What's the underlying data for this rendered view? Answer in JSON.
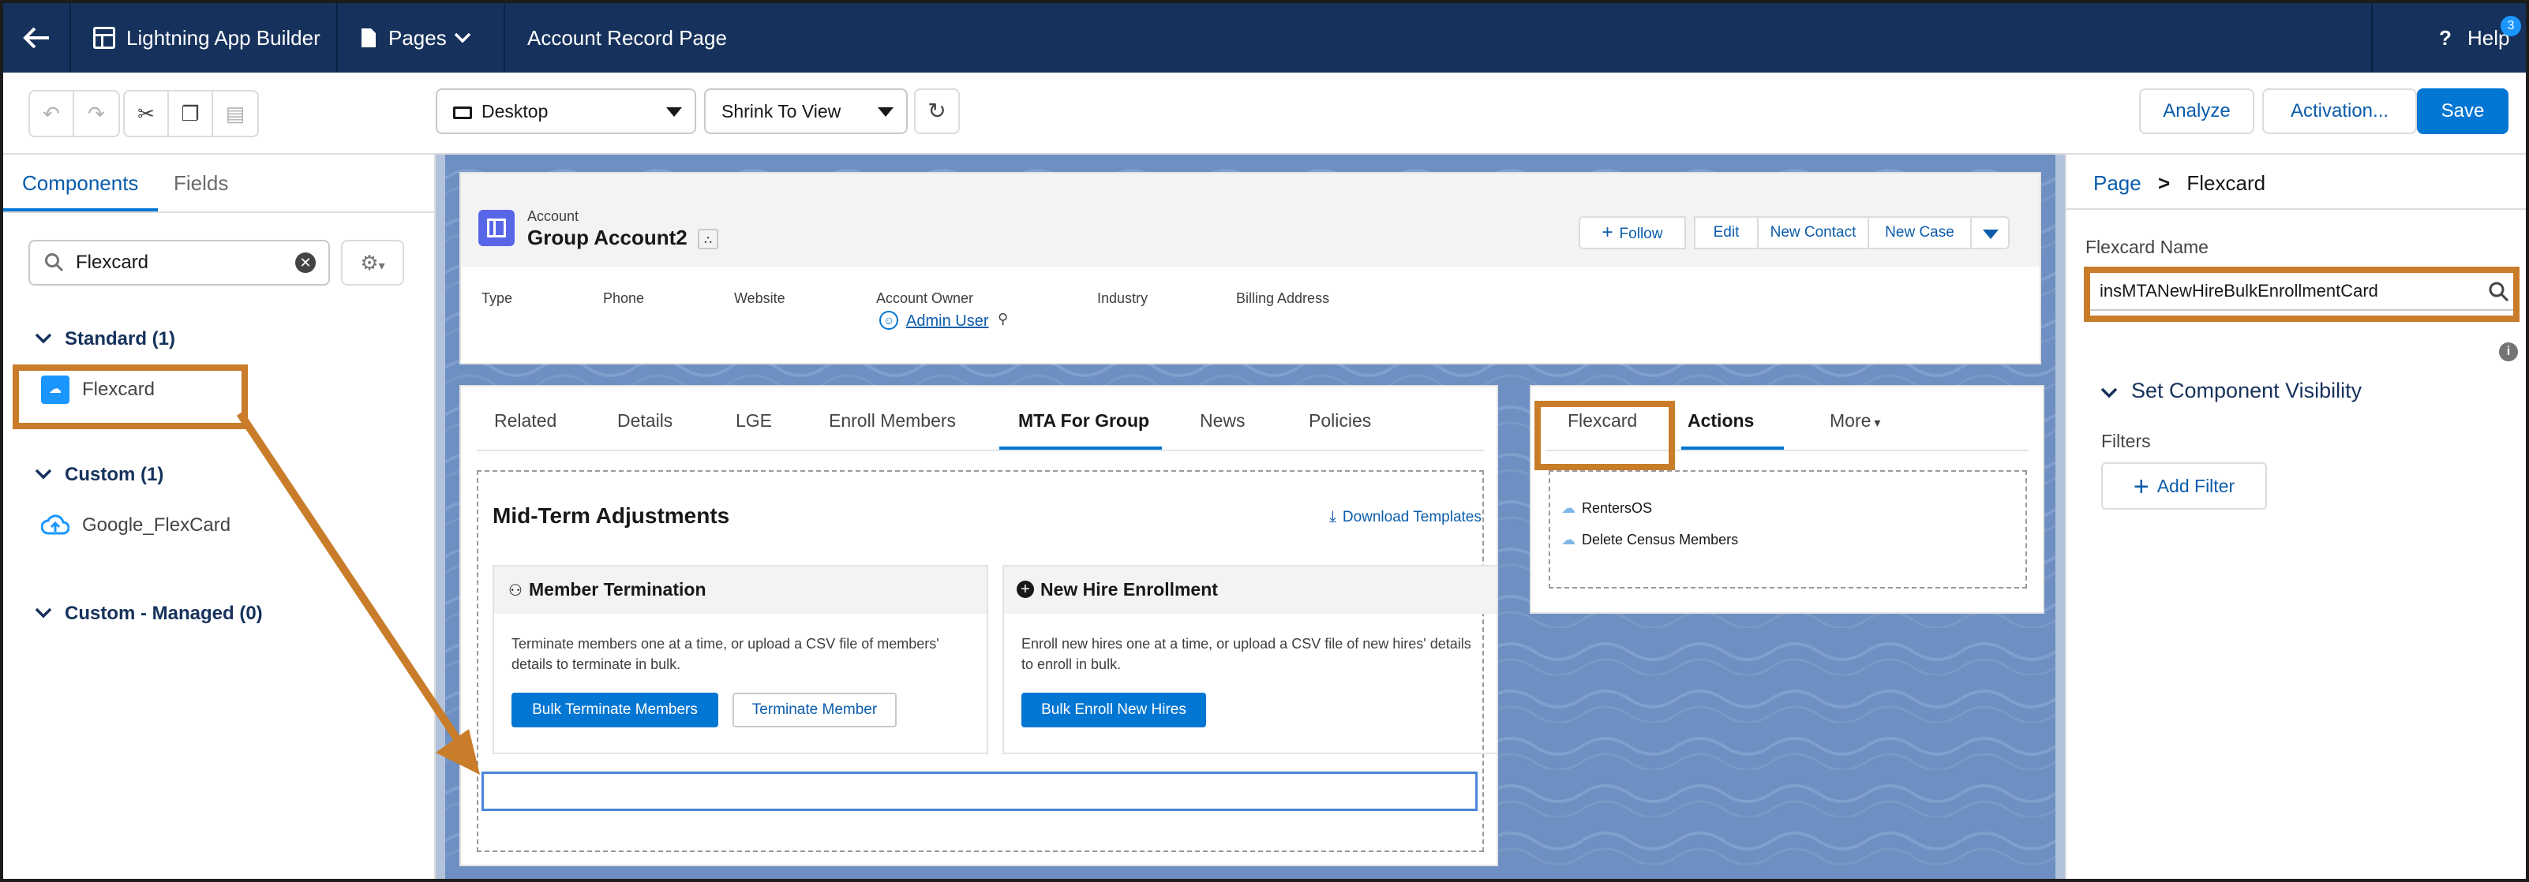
{
  "topbar": {
    "app_name": "Lightning App Builder",
    "pages_label": "Pages",
    "page_name": "Account Record Page",
    "help_label": "Help",
    "help_badge": "3"
  },
  "toolbar": {
    "device_select": "Desktop",
    "view_select": "Shrink To View",
    "analyze_label": "Analyze",
    "activation_label": "Activation...",
    "save_label": "Save"
  },
  "left_panel": {
    "tabs": [
      "Components",
      "Fields"
    ],
    "search_value": "Flexcard",
    "sections": [
      {
        "title": "Standard (1)",
        "items": [
          "Flexcard"
        ]
      },
      {
        "title": "Custom (1)",
        "items": [
          "Google_FlexCard"
        ]
      },
      {
        "title": "Custom - Managed (0)",
        "items": []
      }
    ]
  },
  "record": {
    "object_label": "Account",
    "record_name": "Group Account2",
    "actions": [
      "Follow",
      "Edit",
      "New Contact",
      "New Case"
    ],
    "fields": [
      "Type",
      "Phone",
      "Website",
      "Account Owner",
      "Industry",
      "Billing Address"
    ],
    "owner_value": "Admin User"
  },
  "main_tabs": [
    "Related",
    "Details",
    "LGE",
    "Enroll Members",
    "MTA For Group",
    "News",
    "Policies"
  ],
  "mta": {
    "title": "Mid-Term Adjustments",
    "download_label": "Download Templates",
    "termination": {
      "title": "Member Termination",
      "desc_line1": "Terminate members one at a time, or upload a CSV file of members'",
      "desc_line2": "details to terminate in bulk.",
      "primary": "Bulk Terminate Members",
      "secondary": "Terminate Member"
    },
    "enrollment": {
      "title": "New Hire Enrollment",
      "desc_line1": "Enroll new hires one at a time, or upload a CSV file of new hires' details",
      "desc_line2": "to enroll in bulk.",
      "primary": "Bulk Enroll New Hires"
    }
  },
  "side_tabs": [
    "Flexcard",
    "Actions",
    "More"
  ],
  "side_actions": [
    "RentersOS",
    "Delete Census Members"
  ],
  "right_panel": {
    "breadcrumb_page": "Page",
    "breadcrumb_sep": ">",
    "breadcrumb_current": "Flexcard",
    "name_label": "Flexcard Name",
    "name_value": "insMTANewHireBulkEnrollmentCard",
    "visibility_title": "Set Component Visibility",
    "filters_label": "Filters",
    "add_filter_label": "Add Filter"
  },
  "colors": {
    "nav_bg": "#16325c",
    "accent": "#0176d3",
    "highlight": "#c97c2a"
  }
}
